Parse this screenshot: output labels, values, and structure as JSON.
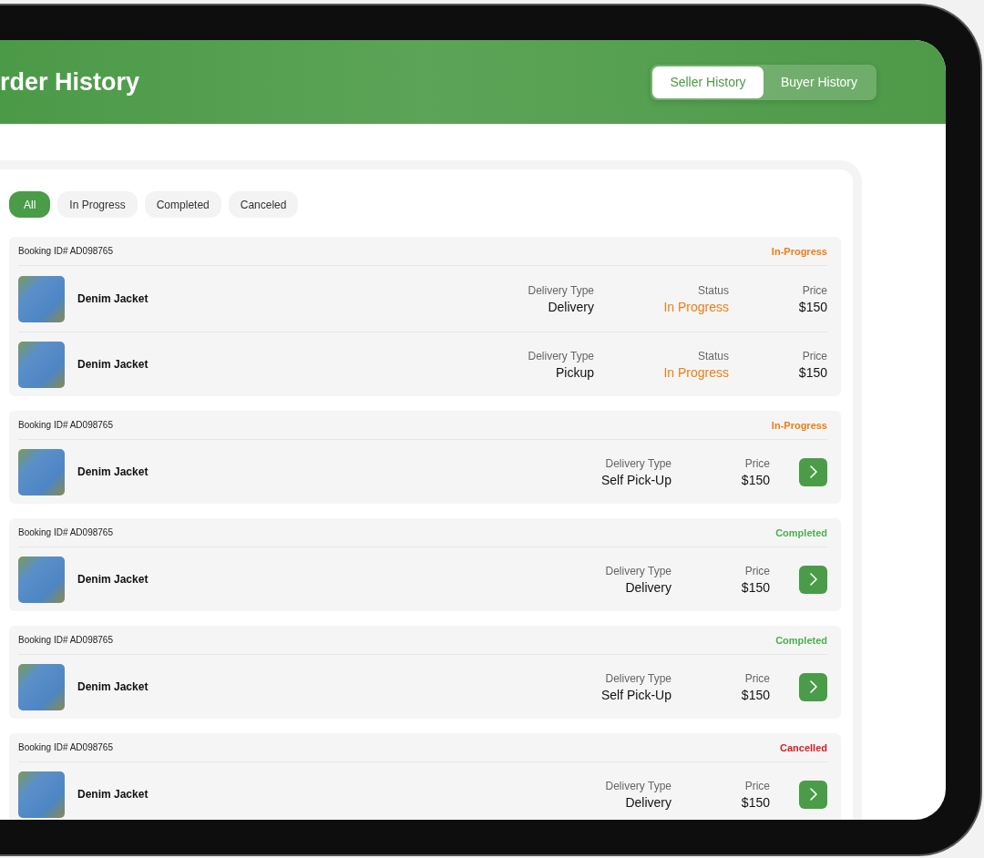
{
  "header": {
    "title": "rder History",
    "toggle": [
      {
        "label": "Seller History",
        "selected": true
      },
      {
        "label": "Buyer History",
        "selected": false
      }
    ]
  },
  "filters": [
    {
      "label": "All",
      "selected": true
    },
    {
      "label": "In Progress",
      "selected": false
    },
    {
      "label": "Completed",
      "selected": false
    },
    {
      "label": "Canceled",
      "selected": false
    }
  ],
  "orders": [
    {
      "booking_id": "Booking ID# AD098765",
      "status": "In-Progress",
      "color": "#f07d14",
      "items": [
        {
          "name": "Denim Jacket",
          "arrow": false,
          "fields": [
            {
              "label": "Delivery Type",
              "value": "Delivery",
              "kind": "plain"
            },
            {
              "label": "Status",
              "value": "In Progress",
              "kind": "status"
            },
            {
              "label": "Price",
              "value": "$150",
              "kind": "plain"
            }
          ]
        },
        {
          "name": "Denim Jacket",
          "arrow": false,
          "fields": [
            {
              "label": "Delivery Type",
              "value": "Pickup",
              "kind": "plain"
            },
            {
              "label": "Status",
              "value": "In Progress",
              "kind": "status"
            },
            {
              "label": "Price",
              "value": "$150",
              "kind": "plain"
            }
          ]
        }
      ]
    },
    {
      "booking_id": "Booking ID# AD098765",
      "status": "In-Progress",
      "color": "#f07d14",
      "items": [
        {
          "name": "Denim Jacket",
          "arrow": true,
          "fields": [
            {
              "label": "Delivery Type",
              "value": "Self Pick-Up",
              "kind": "plain"
            },
            {
              "label": "Price",
              "value": "$150",
              "kind": "plain"
            }
          ]
        }
      ]
    },
    {
      "booking_id": "Booking ID# AD098765",
      "status": "Completed",
      "color": "#4caf50",
      "items": [
        {
          "name": "Denim Jacket",
          "arrow": true,
          "fields": [
            {
              "label": "Delivery Type",
              "value": "Delivery",
              "kind": "plain"
            },
            {
              "label": "Price",
              "value": "$150",
              "kind": "plain"
            }
          ]
        }
      ]
    },
    {
      "booking_id": "Booking ID# AD098765",
      "status": "Completed",
      "color": "#4caf50",
      "items": [
        {
          "name": "Denim Jacket",
          "arrow": true,
          "fields": [
            {
              "label": "Delivery Type",
              "value": "Self Pick-Up",
              "kind": "plain"
            },
            {
              "label": "Price",
              "value": "$150",
              "kind": "plain"
            }
          ]
        }
      ]
    },
    {
      "booking_id": "Booking ID# AD098765",
      "status": "Cancelled",
      "color": "#d81f1f",
      "items": [
        {
          "name": "Denim Jacket",
          "arrow": true,
          "fields": [
            {
              "label": "Delivery Type",
              "value": "Delivery",
              "kind": "plain"
            },
            {
              "label": "Price",
              "value": "$150",
              "kind": "plain"
            }
          ]
        }
      ]
    }
  ]
}
